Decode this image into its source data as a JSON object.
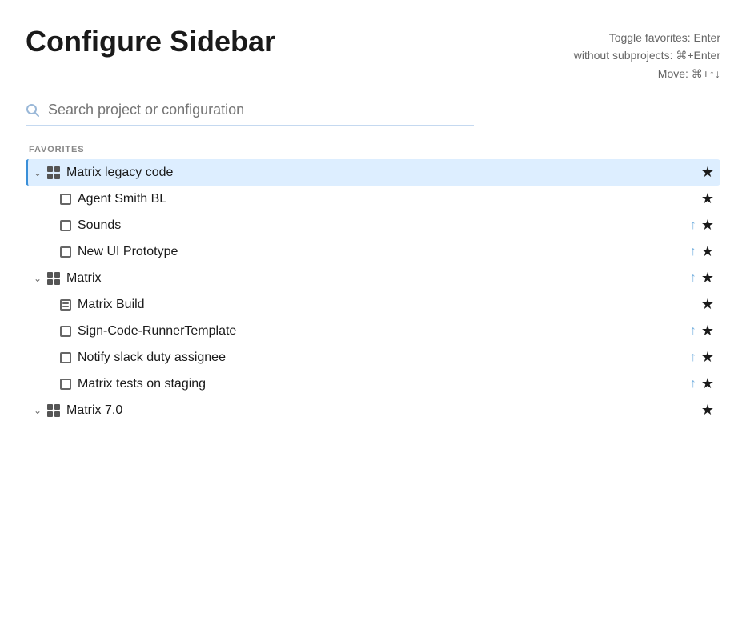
{
  "header": {
    "title": "Configure Sidebar",
    "keyboard_hints": {
      "line1": "Toggle favorites: Enter",
      "line2": "without subprojects: ⌘+Enter",
      "line3": "Move: ⌘+↑↓"
    }
  },
  "search": {
    "placeholder": "Search project or configuration"
  },
  "sections": [
    {
      "id": "favorites",
      "label": "FAVORITES",
      "items": [
        {
          "id": "matrix-legacy",
          "type": "project",
          "expanded": true,
          "active": true,
          "label": "Matrix legacy code",
          "hasChevron": true,
          "hasUpArrow": false,
          "starred": true
        },
        {
          "id": "agent-smith",
          "type": "subitem",
          "label": "Agent Smith BL",
          "hasUpArrow": false,
          "starred": true
        },
        {
          "id": "sounds",
          "type": "subitem",
          "label": "Sounds",
          "hasUpArrow": true,
          "starred": true
        },
        {
          "id": "new-ui-prototype",
          "type": "subitem",
          "label": "New UI Prototype",
          "hasUpArrow": true,
          "starred": true
        },
        {
          "id": "matrix",
          "type": "project",
          "expanded": true,
          "active": false,
          "label": "Matrix",
          "hasChevron": true,
          "hasUpArrow": true,
          "starred": true
        },
        {
          "id": "matrix-build",
          "type": "subitem-build",
          "label": "Matrix Build",
          "hasUpArrow": false,
          "starred": true
        },
        {
          "id": "sign-code-runner",
          "type": "subitem",
          "label": "Sign-Code-RunnerTemplate",
          "hasUpArrow": true,
          "starred": true
        },
        {
          "id": "notify-slack",
          "type": "subitem",
          "label": "Notify slack duty assignee",
          "hasUpArrow": true,
          "starred": true
        },
        {
          "id": "matrix-tests",
          "type": "subitem",
          "label": "Matrix tests on staging",
          "hasUpArrow": true,
          "starred": true
        },
        {
          "id": "matrix-7",
          "type": "project",
          "expanded": true,
          "active": false,
          "label": "Matrix 7.0",
          "hasChevron": true,
          "hasUpArrow": false,
          "starred": true
        }
      ]
    }
  ]
}
